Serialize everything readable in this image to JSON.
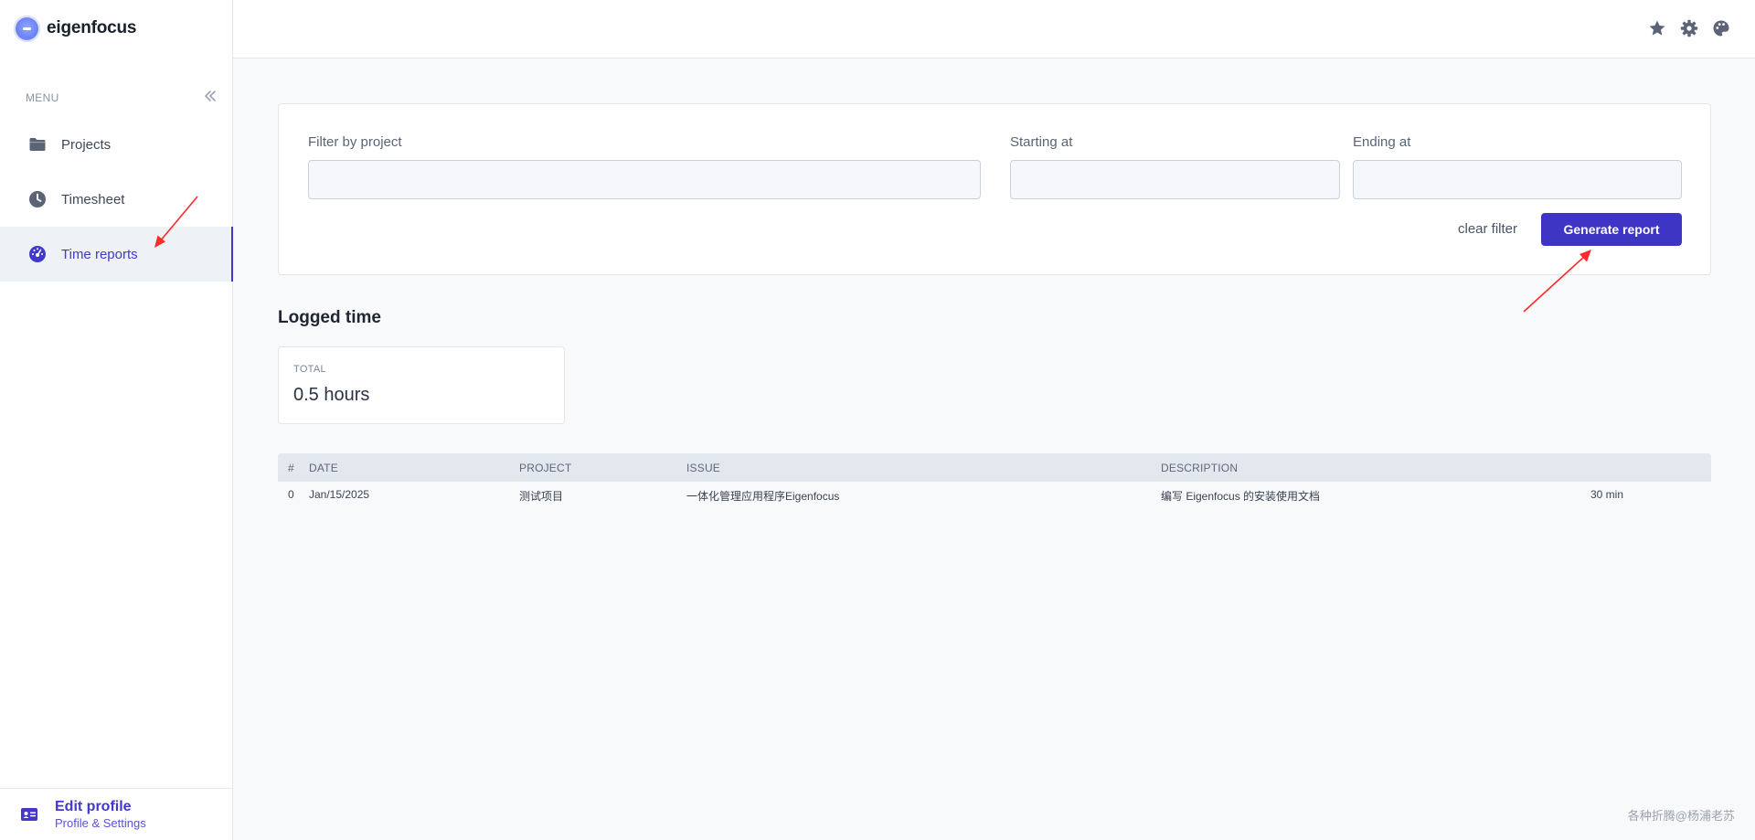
{
  "brand": {
    "name": "eigenfocus"
  },
  "sidebar": {
    "menu_label": "MENU",
    "items": [
      {
        "label": "Projects",
        "icon": "folder-icon",
        "active": false
      },
      {
        "label": "Timesheet",
        "icon": "clock-icon",
        "active": false
      },
      {
        "label": "Time reports",
        "icon": "dashboard-icon",
        "active": true
      }
    ],
    "footer": {
      "title": "Edit profile",
      "subtitle": "Profile & Settings",
      "icon": "id-card-icon"
    }
  },
  "topbar": {
    "icons": [
      "star-icon",
      "gear-icon",
      "palette-icon"
    ]
  },
  "filter": {
    "project_label": "Filter by project",
    "project_value": "",
    "start_label": "Starting at",
    "start_value": "",
    "end_label": "Ending at",
    "end_value": "",
    "clear_label": "clear filter",
    "generate_label": "Generate report"
  },
  "logged": {
    "title": "Logged time",
    "total_label": "TOTAL",
    "total_value": "0.5 hours"
  },
  "table": {
    "headers": [
      "#",
      "DATE",
      "PROJECT",
      "ISSUE",
      "DESCRIPTION"
    ],
    "rows": [
      {
        "num": "0",
        "date": "Jan/15/2025",
        "project": "测试项目",
        "issue": "一体化管理应用程序Eigenfocus",
        "description": "编写 Eigenfocus 的安装使用文档",
        "duration": "30 min"
      }
    ]
  },
  "watermark": "各种折腾@杨浦老苏",
  "colors": {
    "accent": "#3f35c4",
    "active_nav": "#3f3ac9",
    "annotation": "#ff2a2a"
  }
}
